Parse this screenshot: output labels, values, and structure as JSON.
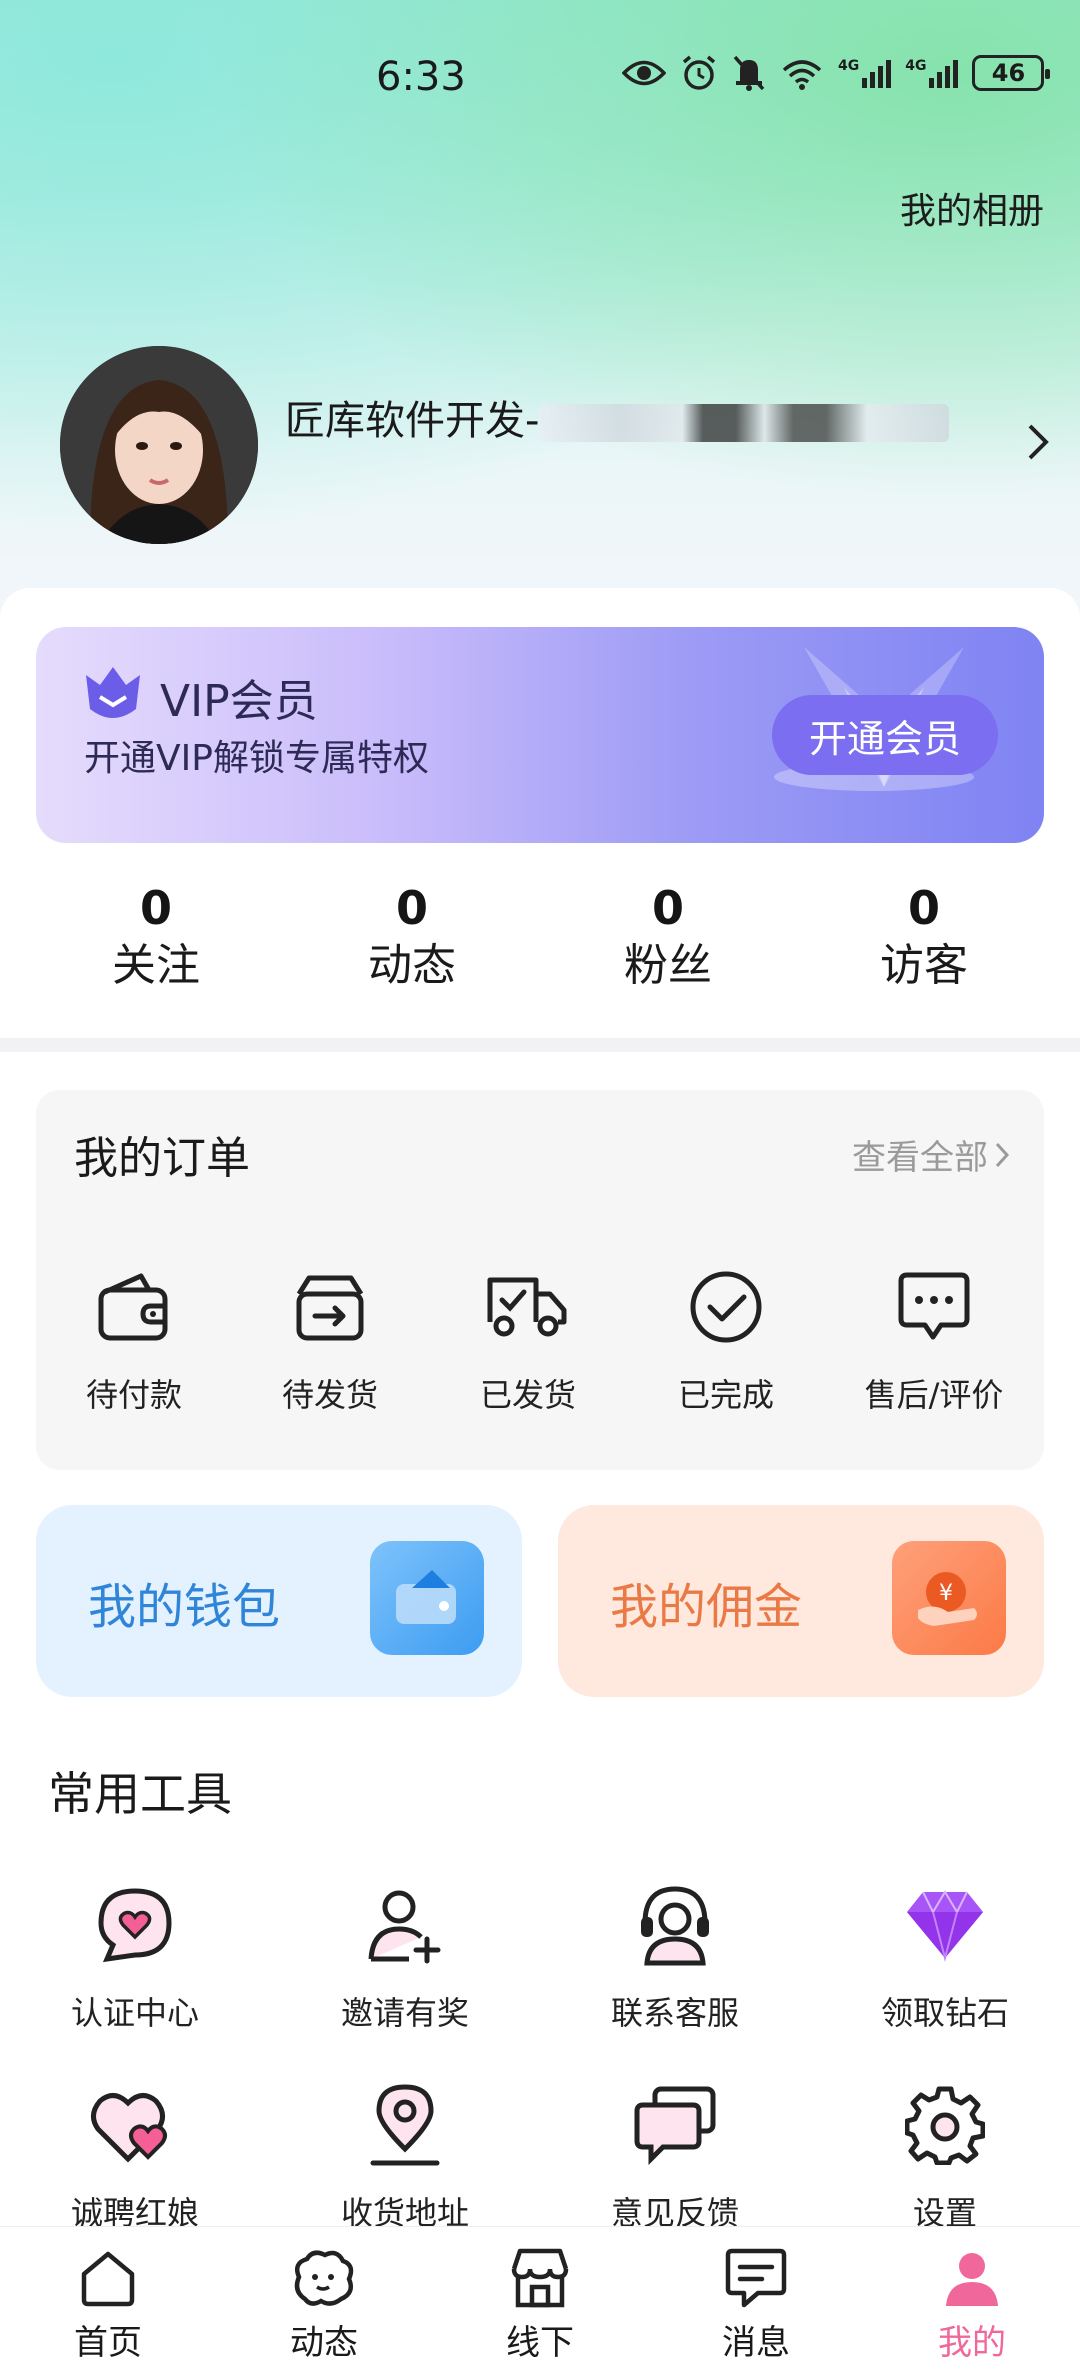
{
  "status_bar": {
    "time": "6:33",
    "battery": "46",
    "network_1": "4G",
    "network_2": "4G"
  },
  "header": {
    "album_link": "我的相册"
  },
  "profile": {
    "name": "匠库软件开发-"
  },
  "vip": {
    "title": "VIP会员",
    "subtitle": "开通VIP解锁专属特权",
    "button": "开通会员"
  },
  "stats": [
    {
      "value": "0",
      "label": "关注"
    },
    {
      "value": "0",
      "label": "动态"
    },
    {
      "value": "0",
      "label": "粉丝"
    },
    {
      "value": "0",
      "label": "访客"
    }
  ],
  "orders": {
    "title": "我的订单",
    "view_all": "查看全部",
    "items": [
      {
        "label": "待付款",
        "icon": "wallet-icon"
      },
      {
        "label": "待发货",
        "icon": "box-out-icon"
      },
      {
        "label": "已发货",
        "icon": "truck-icon"
      },
      {
        "label": "已完成",
        "icon": "check-circle-icon"
      },
      {
        "label": "售后/评价",
        "icon": "chat-bubble-icon"
      }
    ]
  },
  "finance": {
    "wallet": "我的钱包",
    "commission": "我的佣金"
  },
  "tools": {
    "title": "常用工具",
    "items": [
      {
        "label": "认证中心",
        "icon": "heart-bubble-icon"
      },
      {
        "label": "邀请有奖",
        "icon": "user-add-icon"
      },
      {
        "label": "联系客服",
        "icon": "headset-icon"
      },
      {
        "label": "领取钻石",
        "icon": "diamond-icon"
      },
      {
        "label": "诚聘红娘",
        "icon": "double-heart-icon"
      },
      {
        "label": "收货地址",
        "icon": "location-pin-icon"
      },
      {
        "label": "意见反馈",
        "icon": "feedback-icon"
      },
      {
        "label": "设置",
        "icon": "gear-icon"
      }
    ]
  },
  "tabbar": [
    {
      "label": "首页",
      "icon": "home-icon"
    },
    {
      "label": "动态",
      "icon": "moments-icon"
    },
    {
      "label": "线下",
      "icon": "store-icon"
    },
    {
      "label": "消息",
      "icon": "message-icon"
    },
    {
      "label": "我的",
      "icon": "profile-icon",
      "active": true
    }
  ],
  "colors": {
    "accent_pink": "#f0679b",
    "vip_purple": "#7b6ef0",
    "wallet_blue": "#2f85d8",
    "commission_orange": "#ea7a45"
  }
}
